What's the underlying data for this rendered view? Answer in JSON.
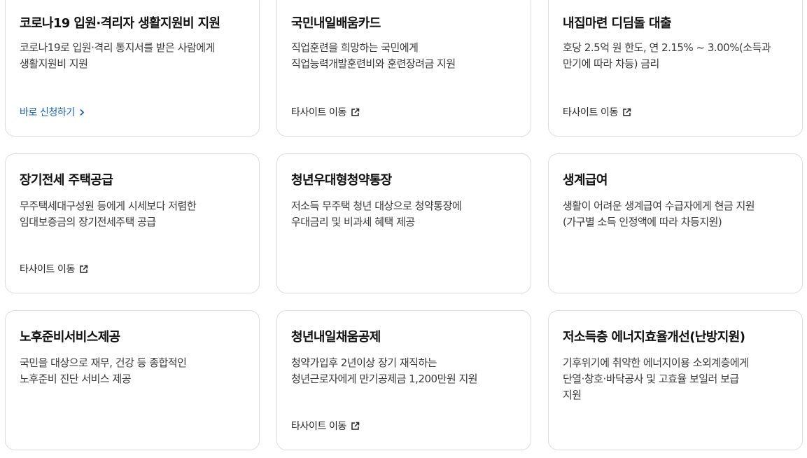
{
  "cards": [
    {
      "title": "코로나19 입원·격리자 생활지원비 지원",
      "desc": [
        "코로나19로 입원·격리 통지서를 받은 사람에게",
        "생활지원비 지원"
      ],
      "link": {
        "label": "바로 신청하기",
        "icon": "chevron-right-icon"
      }
    },
    {
      "title": "국민내일배움카드",
      "desc": [
        "직업훈련을 희망하는 국민에게",
        "직업능력개발훈련비와 훈련장려금 지원"
      ],
      "link": {
        "label": "타사이트 이동",
        "icon": "external-link-icon"
      }
    },
    {
      "title": "내집마련 디딤돌 대출",
      "desc": [
        "호당 2.5억 원 한도, 연 2.15% ~ 3.00%(소득과",
        "만기에 따라 차등) 금리"
      ],
      "link": {
        "label": "타사이트 이동",
        "icon": "external-link-icon"
      }
    },
    {
      "title": "장기전세 주택공급",
      "desc": [
        "무주택세대구성원 등에게 시세보다 저렴한",
        "임대보증금의 장기전세주택 공급"
      ],
      "link": {
        "label": "타사이트 이동",
        "icon": "external-link-icon"
      }
    },
    {
      "title": "청년우대형청약통장",
      "desc": [
        "저소득 무주택 청년 대상으로 청약통장에",
        "우대금리 및 비과세 혜택 제공"
      ],
      "link": null
    },
    {
      "title": "생계급여",
      "desc": [
        "생활이 어려운 생계급여 수급자에게 현금 지원",
        "(가구별 소득 인정액에 따라 차등지원)"
      ],
      "link": null
    },
    {
      "title": "노후준비서비스제공",
      "desc": [
        "국민을 대상으로 재무, 건강 등 종합적인",
        "노후준비 진단 서비스 제공"
      ],
      "link": null
    },
    {
      "title": "청년내일채움공제",
      "desc": [
        "청약가입후 2년이상 장기 재직하는",
        "청년근로자에게 만기공제금 1,200만원 지원"
      ],
      "link": {
        "label": "타사이트 이동",
        "icon": "external-link-icon"
      }
    },
    {
      "title": "저소득층 에너지효율개선(난방지원)",
      "desc": [
        "기후위기에 취약한 에너지이용 소외계층에게",
        "단열·창호·바닥공사 및 고효율 보일러 보급",
        "지원"
      ],
      "link": null
    }
  ],
  "colors": {
    "link_primary": "#1560bd",
    "border": "#dcdcdc"
  }
}
